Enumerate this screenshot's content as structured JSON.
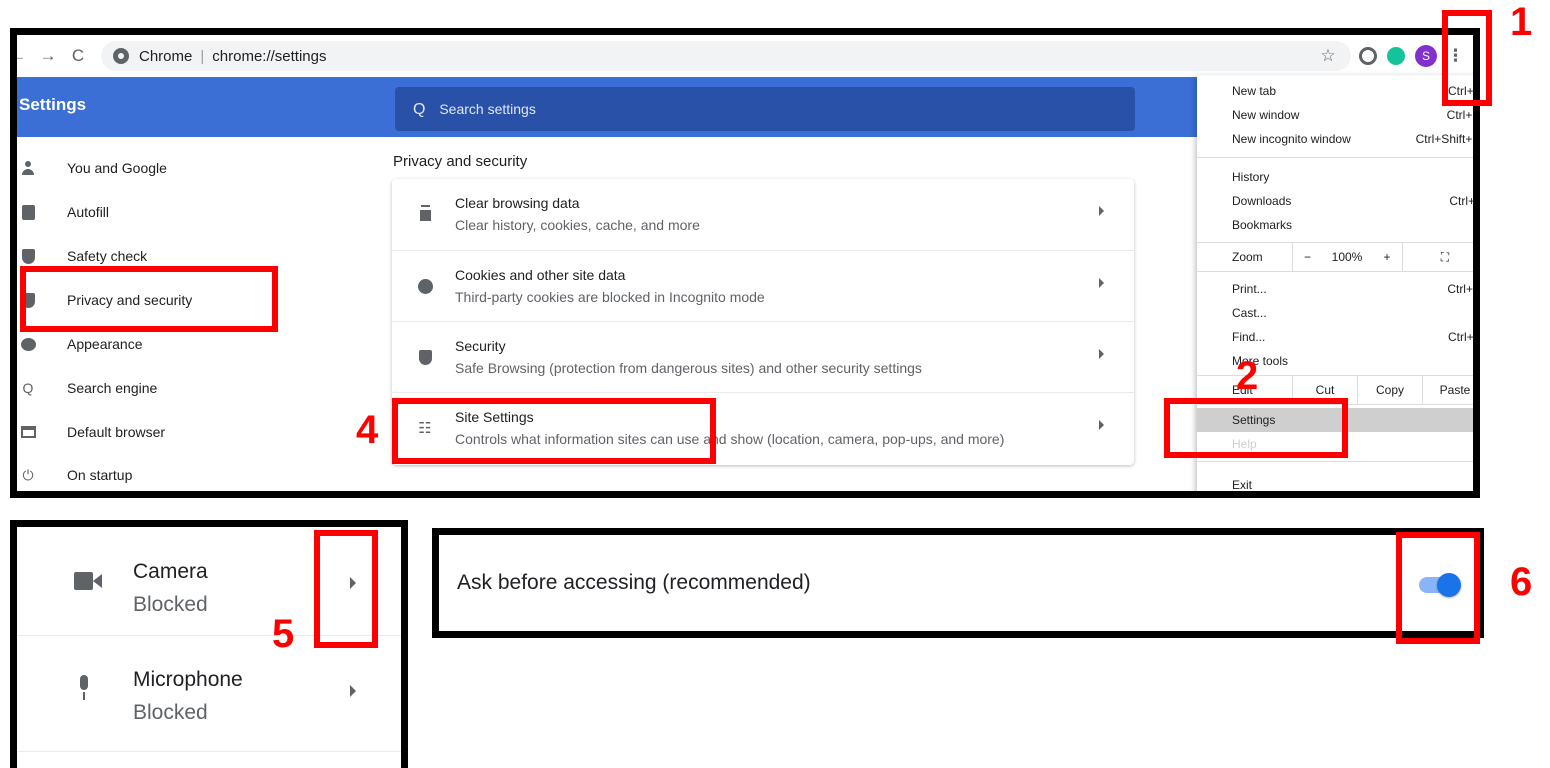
{
  "toolbar": {
    "back_glyph": "←",
    "forward_glyph": "→",
    "reload_glyph": "C",
    "site_name": "Chrome",
    "separator": "|",
    "url": "chrome://settings",
    "star_glyph": "☆",
    "avatar_letter": "S",
    "menu_glyph": "⋮",
    "ext_colors": [
      "#5f6368",
      "#15c39a"
    ]
  },
  "header": {
    "title": "Settings",
    "search_placeholder": "Search settings",
    "search_glyph": "Q",
    "color": "#3b6fd6"
  },
  "sidebar": {
    "items": [
      {
        "label": "You and Google",
        "icon": "person-icon"
      },
      {
        "label": "Autofill",
        "icon": "clipboard-icon"
      },
      {
        "label": "Safety check",
        "icon": "shield-check-icon"
      },
      {
        "label": "Privacy and security",
        "icon": "shield-icon"
      },
      {
        "label": "Appearance",
        "icon": "palette-icon"
      },
      {
        "label": "Search engine",
        "icon": "search-icon"
      },
      {
        "label": "Default browser",
        "icon": "browser-icon"
      },
      {
        "label": "On startup",
        "icon": "power-icon"
      }
    ]
  },
  "main": {
    "section_title": "Privacy and security",
    "rows": [
      {
        "title": "Clear browsing data",
        "subtitle": "Clear history, cookies, cache, and more",
        "icon": "trash-icon"
      },
      {
        "title": "Cookies and other site data",
        "subtitle": "Third-party cookies are blocked in Incognito mode",
        "icon": "cookie-icon"
      },
      {
        "title": "Security",
        "subtitle": "Safe Browsing (protection from dangerous sites) and other security settings",
        "icon": "shield-icon"
      },
      {
        "title": "Site Settings",
        "subtitle": "Controls what information sites can use and show (location, camera, pop-ups, and more)",
        "icon": "tune-icon"
      }
    ]
  },
  "menu": {
    "new_tab": {
      "label": "New tab",
      "shortcut": "Ctrl+T"
    },
    "new_window": {
      "label": "New window",
      "shortcut": "Ctrl+N"
    },
    "new_incognito": {
      "label": "New incognito window",
      "shortcut": "Ctrl+Shift+N"
    },
    "history": {
      "label": "History"
    },
    "downloads": {
      "label": "Downloads",
      "shortcut": "Ctrl+J"
    },
    "bookmarks": {
      "label": "Bookmarks"
    },
    "zoom": {
      "label": "Zoom",
      "minus": "−",
      "level": "100%",
      "plus": "+",
      "fullscreen_glyph": "⛶"
    },
    "print": {
      "label": "Print...",
      "shortcut": "Ctrl+P"
    },
    "cast": {
      "label": "Cast..."
    },
    "find": {
      "label": "Find...",
      "shortcut": "Ctrl+F"
    },
    "more_tools": {
      "label": "More tools"
    },
    "edit": {
      "label": "Edit",
      "cut": "Cut",
      "copy": "Copy",
      "paste": "Paste"
    },
    "settings": {
      "label": "Settings"
    },
    "help": {
      "label": "Help"
    },
    "exit": {
      "label": "Exit"
    }
  },
  "permissions": [
    {
      "name": "Camera",
      "status": "Blocked",
      "icon": "camera-icon"
    },
    {
      "name": "Microphone",
      "status": "Blocked",
      "icon": "microphone-icon"
    }
  ],
  "ask": {
    "label": "Ask before accessing (recommended)",
    "toggle_on": true,
    "toggle_color": "#1a73e8"
  },
  "annotations": {
    "step1": "1",
    "step2": "2",
    "step4": "4",
    "step5": "5",
    "step6": "6",
    "color": "#ff0000"
  }
}
